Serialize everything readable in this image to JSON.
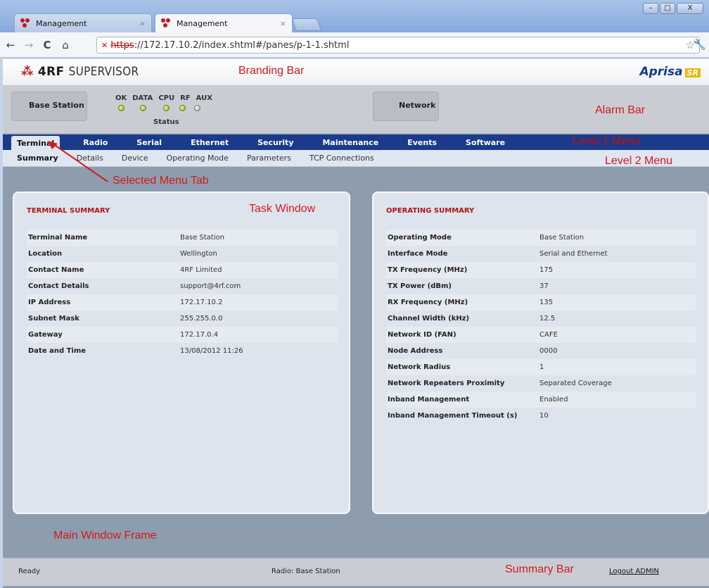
{
  "browser": {
    "tabs": [
      {
        "label": "Management",
        "close": "×"
      },
      {
        "label": "Management",
        "close": "×"
      }
    ],
    "window_controls": {
      "minimize": "–",
      "maximize": "□",
      "close": "X"
    },
    "nav": {
      "back": "←",
      "forward": "→",
      "reload": "C",
      "home": "⌂"
    },
    "url_scheme": "https",
    "url_rest": "://172.17.10.2/index.shtml#/panes/p-1-1.shtml",
    "bookmark": "☆",
    "settings": "🔧"
  },
  "branding": {
    "logo_mark": "⁂",
    "logo_brand": "4RF",
    "logo_product": "SUPERVISOR",
    "product_name": "Aprisa",
    "product_suffix": "SR"
  },
  "alarm_bar": {
    "base_station": "Base Station",
    "network": "Network",
    "led_labels": [
      "OK",
      "DATA",
      "CPU",
      "RF",
      "AUX"
    ],
    "led_states": [
      "on",
      "on",
      "on",
      "on",
      "off"
    ],
    "status_label": "Status"
  },
  "menu_level1": {
    "items": [
      "Terminal",
      "Radio",
      "Serial",
      "Ethernet",
      "Security",
      "Maintenance",
      "Events",
      "Software"
    ],
    "selected": "Terminal"
  },
  "menu_level2": {
    "items": [
      "Summary",
      "Details",
      "Device",
      "Operating Mode",
      "Parameters",
      "TCP Connections"
    ],
    "selected": "Summary"
  },
  "terminal_summary": {
    "title": "TERMINAL SUMMARY",
    "rows": [
      {
        "key": "Terminal Name",
        "value": "Base Station"
      },
      {
        "key": "Location",
        "value": "Wellington"
      },
      {
        "key": "Contact Name",
        "value": "4RF Limited"
      },
      {
        "key": "Contact Details",
        "value": "support@4rf.com"
      },
      {
        "key": "IP Address",
        "value": "172.17.10.2"
      },
      {
        "key": "Subnet Mask",
        "value": "255.255.0.0"
      },
      {
        "key": "Gateway",
        "value": "172.17.0.4"
      },
      {
        "key": "Date and Time",
        "value": "13/08/2012 11:26"
      }
    ]
  },
  "operating_summary": {
    "title": "OPERATING SUMMARY",
    "rows": [
      {
        "key": "Operating Mode",
        "value": "Base Station"
      },
      {
        "key": "Interface Mode",
        "value": "Serial and Ethernet"
      },
      {
        "key": "TX Frequency (MHz)",
        "value": "175"
      },
      {
        "key": "TX Power (dBm)",
        "value": "37"
      },
      {
        "key": "RX Frequency (MHz)",
        "value": "135"
      },
      {
        "key": "Channel Width (kHz)",
        "value": "12.5"
      },
      {
        "key": "Network ID (FAN)",
        "value": "CAFE"
      },
      {
        "key": "Node Address",
        "value": "0000"
      },
      {
        "key": "Network Radius",
        "value": "1"
      },
      {
        "key": "Network Repeaters Proximity",
        "value": "Separated Coverage"
      },
      {
        "key": "Inband Management",
        "value": "Enabled"
      },
      {
        "key": "Inband Management Timeout (s)",
        "value": "10"
      }
    ]
  },
  "status_bar": {
    "ready": "Ready",
    "radio": "Radio: Base Station",
    "logout": "Logout ADMIN"
  },
  "annotations": {
    "branding_bar": "Branding Bar",
    "alarm_bar": "Alarm Bar",
    "level1_menu": "Level 1 Menu",
    "level2_menu": "Level 2 Menu",
    "selected_menu_tab": "Selected Menu Tab",
    "task_window": "Task Window",
    "main_window_frame": "Main Window Frame",
    "summary_bar": "Summary Bar",
    "color": "#d21a1a"
  }
}
